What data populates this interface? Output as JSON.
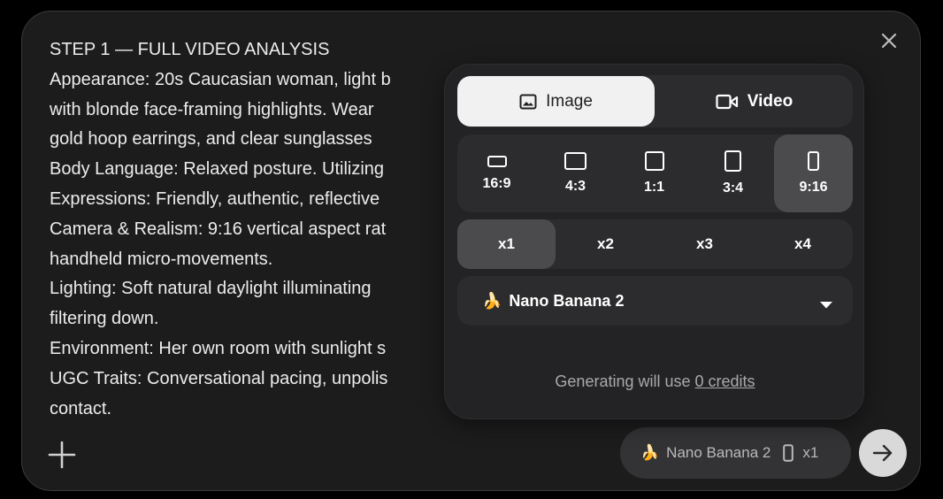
{
  "prompt": {
    "lines": [
      "STEP 1 — FULL VIDEO ANALYSIS",
      "Appearance: 20s Caucasian woman, light b",
      "with blonde face-framing highlights. Wear",
      "gold hoop earrings, and clear sunglasses",
      "Body Language: Relaxed posture. Utilizing",
      "Expressions: Friendly, authentic, reflective",
      "Camera & Realism: 9:16 vertical aspect rat",
      "handheld micro-movements.",
      "Lighting: Soft natural daylight illuminating",
      "filtering down.",
      "Environment: Her own room with sunlight s",
      "UGC Traits: Conversational pacing, unpolis",
      "contact."
    ]
  },
  "mode": {
    "image_label": "Image",
    "video_label": "Video",
    "selected": "Image"
  },
  "aspect_ratios": {
    "options": [
      "16:9",
      "4:3",
      "1:1",
      "3:4",
      "9:16"
    ],
    "selected": "9:16"
  },
  "count": {
    "options": [
      "x1",
      "x2",
      "x3",
      "x4"
    ],
    "selected": "x1"
  },
  "model": {
    "emoji": "🍌",
    "name": "Nano Banana 2"
  },
  "credits": {
    "prefix": "Generating will use",
    "link": "0 credits"
  },
  "chip": {
    "emoji": "🍌",
    "model": "Nano Banana 2",
    "count": "x1"
  },
  "icons": {
    "close": "close-icon",
    "plus": "plus-icon",
    "send": "arrow-right-icon",
    "image": "image-icon",
    "video": "video-camera-icon",
    "dropdown": "caret-down-icon"
  },
  "colors": {
    "card_bg": "#1c1c1d",
    "panel_bg": "#232325",
    "segment_bg": "#2c2c2e",
    "selected_bg": "#4b4b4e",
    "active_tab_bg": "#f1f1f1"
  }
}
